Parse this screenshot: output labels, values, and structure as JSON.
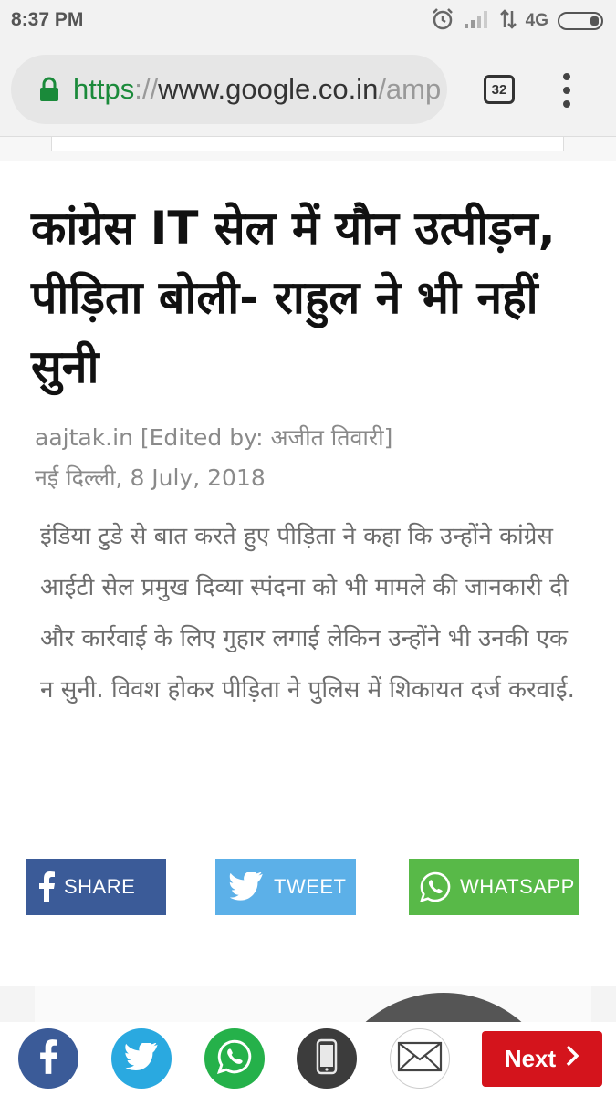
{
  "status_bar": {
    "time": "8:37 PM",
    "network_label": "4G",
    "icons": [
      "alarm-icon",
      "signal-icon",
      "data-arrows-icon",
      "battery-icon"
    ]
  },
  "browser": {
    "url_scheme": "https",
    "url_separator": "://",
    "url_host": "www.google.co.in",
    "url_tail": "/amp",
    "tab_count": "32",
    "icons": [
      "lock-icon",
      "tabs-icon",
      "overflow-menu-icon"
    ]
  },
  "article": {
    "headline": "कांग्रेस IT सेल में यौन उत्पीड़न, पीड़िता बोली- राहुल ने भी नहीं सुनी",
    "source": "aajtak.in [Edited by: अजीत तिवारी]",
    "dateline": "नई दिल्ली, 8 July, 2018",
    "summary": "इंडिया टुडे से बात करते हुए पीड़िता ने कहा कि उन्होंने कांग्रेस आईटी सेल प्रमुख दिव्या स्पंदना को भी मामले की जानकारी दी और कार्रवाई के लिए गुहार लगाई लेकिन उन्होंने भी उनकी एक न सुनी. विवश होकर पीड़िता ने पुलिस में शिकायत दर्ज करवाई."
  },
  "share": {
    "facebook_label": "SHARE",
    "twitter_label": "TWEET",
    "whatsapp_label": "WHATSAPP"
  },
  "bottom_bar": {
    "next_label": "Next",
    "icons": [
      "facebook-icon",
      "twitter-icon",
      "whatsapp-icon",
      "phone-icon",
      "mail-icon",
      "chevron-right-icon"
    ]
  },
  "colors": {
    "facebook": "#3b5b98",
    "twitter": "#5cb0e8",
    "whatsapp": "#58b948",
    "next": "#d4141c",
    "https_green": "#1a8a3a"
  }
}
